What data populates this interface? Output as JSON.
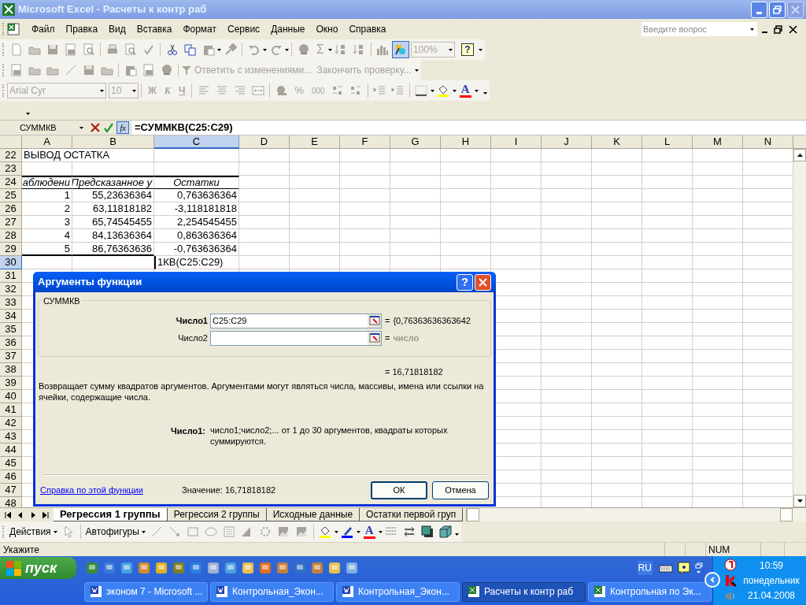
{
  "window": {
    "title": "Microsoft Excel - Расчеты к контр раб"
  },
  "menu": {
    "items": [
      "Файл",
      "Правка",
      "Вид",
      "Вставка",
      "Формат",
      "Сервис",
      "Данные",
      "Окно",
      "Справка"
    ],
    "help_search": {
      "placeholder": "Введите вопрос"
    }
  },
  "standard_toolbar": {
    "sum_symbol": "Σ",
    "zoom": "100%",
    "help_symbol": "?"
  },
  "reviewing_toolbar": {
    "items": [
      "Ответить с изменениями...",
      "Закончить проверку..."
    ]
  },
  "formatting_toolbar": {
    "font": "Arial Cyr",
    "size": "10",
    "style_buttons": [
      "Ж",
      "К",
      "Ч"
    ],
    "percent": "%",
    "thousands": "000",
    "font_color_symbol": "A"
  },
  "formula_bar": {
    "name_box": "СУММКВ",
    "function_button": "fx",
    "formula": "=СУММКВ(C25:C29)"
  },
  "sheet": {
    "columns": [
      {
        "label": "A",
        "selected": false
      },
      {
        "label": "B",
        "selected": false
      },
      {
        "label": "C",
        "selected": true
      },
      {
        "label": "D",
        "selected": false
      },
      {
        "label": "E",
        "selected": false
      },
      {
        "label": "F",
        "selected": false
      },
      {
        "label": "G",
        "selected": false
      },
      {
        "label": "H",
        "selected": false
      },
      {
        "label": "I",
        "selected": false
      },
      {
        "label": "J",
        "selected": false
      },
      {
        "label": "K",
        "selected": false
      },
      {
        "label": "L",
        "selected": false
      },
      {
        "label": "M",
        "selected": false
      },
      {
        "label": "N",
        "selected": false
      }
    ],
    "rows": [
      {
        "number": "22",
        "selected": false,
        "cells": {
          "A": {
            "text": "ВЫВОД ОСТАТКА",
            "kind": "text"
          }
        }
      },
      {
        "number": "23",
        "selected": false
      },
      {
        "number": "24",
        "selected": false,
        "rule_above": true,
        "cells": {
          "A": {
            "text": "аблюдени",
            "kind": "header"
          },
          "B": {
            "text": "Предсказанное у",
            "kind": "header"
          },
          "C": {
            "text": "Остатки",
            "kind": "heading"
          }
        }
      },
      {
        "number": "25",
        "selected": false,
        "cells": {
          "A": {
            "text": "1",
            "kind": "number"
          },
          "B": {
            "text": "55,23636364",
            "kind": "number"
          },
          "C": {
            "text": "0,763636364",
            "kind": "number"
          }
        }
      },
      {
        "number": "26",
        "selected": false,
        "cells": {
          "A": {
            "text": "2",
            "kind": "number"
          },
          "B": {
            "text": "63,11818182",
            "kind": "number"
          },
          "C": {
            "text": "-3,118181818",
            "kind": "number"
          }
        }
      },
      {
        "number": "27",
        "selected": false,
        "cells": {
          "A": {
            "text": "3",
            "kind": "number"
          },
          "B": {
            "text": "65,74545455",
            "kind": "number"
          },
          "C": {
            "text": "2,254545455",
            "kind": "number"
          }
        }
      },
      {
        "number": "28",
        "selected": false,
        "cells": {
          "A": {
            "text": "4",
            "kind": "number"
          },
          "B": {
            "text": "84,13636364",
            "kind": "number"
          },
          "C": {
            "text": "0,863636364",
            "kind": "number"
          }
        }
      },
      {
        "number": "29",
        "selected": false,
        "rule_below": true,
        "cells": {
          "A": {
            "text": "5",
            "kind": "number"
          },
          "B": {
            "text": "86,76363636",
            "kind": "number"
          },
          "C": {
            "text": "-0,763636364",
            "kind": "number"
          }
        }
      },
      {
        "number": "30",
        "selected": true,
        "cells": {
          "C": {
            "text": "1КВ(C25:C29)",
            "kind": "editing"
          }
        }
      },
      {
        "number": "31",
        "selected": false
      },
      {
        "number": "32",
        "selected": false
      },
      {
        "number": "33",
        "selected": false
      },
      {
        "number": "34",
        "selected": false
      },
      {
        "number": "35",
        "selected": false
      },
      {
        "number": "36",
        "selected": false
      },
      {
        "number": "37",
        "selected": false
      },
      {
        "number": "38",
        "selected": false
      },
      {
        "number": "39",
        "selected": false
      },
      {
        "number": "40",
        "selected": false
      },
      {
        "number": "41",
        "selected": false
      },
      {
        "number": "42",
        "selected": false
      },
      {
        "number": "43",
        "selected": false
      },
      {
        "number": "44",
        "selected": false
      },
      {
        "number": "45",
        "selected": false
      },
      {
        "number": "46",
        "selected": false
      },
      {
        "number": "47",
        "selected": false
      },
      {
        "number": "48",
        "selected": false
      }
    ]
  },
  "dialog": {
    "title": "Аргументы функции",
    "help_button": "?",
    "function_name": "СУММКВ",
    "arguments": [
      {
        "label": "Число1",
        "active": true,
        "value": "C25:C29",
        "equals": "=",
        "result": "{0,76363636363642",
        "hint": false
      },
      {
        "label": "Число2",
        "active": false,
        "equals": "=",
        "result": "число",
        "hint": true
      }
    ],
    "total": "= 16,71818182",
    "description": "Возвращает сумму квадратов аргументов. Аргументами могут являться числа, массивы, имена или ссылки на ячейки, содержащие числа.",
    "argument_help": {
      "label": "Число1:",
      "text": "число1;число2;... от 1 до 30 аргументов, квадраты которых суммируются."
    },
    "help_link": "Справка по этой функции",
    "value": "Значение: 16,71818182",
    "buttons": [
      {
        "label": "ОК",
        "default": true
      },
      {
        "label": "Отмена",
        "default": false
      }
    ]
  },
  "sheet_tabs": [
    {
      "label": "Регрессия 1 группы",
      "selected": true
    },
    {
      "label": "Регрессия 2 группы",
      "selected": false
    },
    {
      "label": "Исходные данные",
      "selected": false
    },
    {
      "label": "Остатки первой груп",
      "selected": false
    }
  ],
  "drawing_toolbar": {
    "actions": "Действия",
    "autoshapes": "Автофигуры",
    "font_color_symbol": "A"
  },
  "status_bar": {
    "mode": "Укажите",
    "indicator": "NUM"
  },
  "taskbar": {
    "start": "пуск",
    "tasks": [
      {
        "label": "эконом 7 - Microsoft ...",
        "kind": "word",
        "selected": false
      },
      {
        "label": "Контрольная_Экон...",
        "kind": "word",
        "selected": false
      },
      {
        "label": "Контрольная_Экон...",
        "kind": "word",
        "selected": false
      },
      {
        "label": "Расчеты к контр раб",
        "kind": "excel",
        "selected": true
      },
      {
        "label": "Контрольная по Эк...",
        "kind": "excel",
        "selected": false
      }
    ],
    "language": "RU",
    "time": "10:59",
    "day": "понедельник",
    "date": "21.04.2008"
  }
}
